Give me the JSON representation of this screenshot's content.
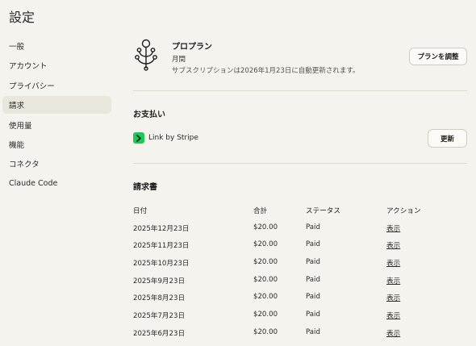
{
  "page": {
    "title": "設定"
  },
  "sidebar": {
    "items": [
      {
        "label": "一般"
      },
      {
        "label": "アカウント"
      },
      {
        "label": "プライバシー"
      },
      {
        "label": "請求",
        "active": true
      },
      {
        "label": "使用量"
      },
      {
        "label": "機能"
      },
      {
        "label": "コネクタ"
      },
      {
        "label": "Claude Code"
      }
    ]
  },
  "plan": {
    "icon": "plan-tree-icon",
    "name": "プロプラン",
    "cycle": "月間",
    "renewal_text": "サブスクリプションは2026年1月23日に自動更新されます。",
    "adjust_label": "プランを調整"
  },
  "payment": {
    "title": "お支払い",
    "method_icon": "link-stripe-icon",
    "method_label": "Link by Stripe",
    "update_label": "更新",
    "accent_color": "#1fc65b"
  },
  "invoices": {
    "title": "請求書",
    "columns": [
      "日付",
      "合計",
      "ステータス",
      "アクション"
    ],
    "rows": [
      {
        "date": "2025年12月23日",
        "total": "$20.00",
        "status": "Paid",
        "action": "表示"
      },
      {
        "date": "2025年11月23日",
        "total": "$20.00",
        "status": "Paid",
        "action": "表示"
      },
      {
        "date": "2025年10月23日",
        "total": "$20.00",
        "status": "Paid",
        "action": "表示"
      },
      {
        "date": "2025年9月23日",
        "total": "$20.00",
        "status": "Paid",
        "action": "表示"
      },
      {
        "date": "2025年8月23日",
        "total": "$20.00",
        "status": "Paid",
        "action": "表示"
      },
      {
        "date": "2025年7月23日",
        "total": "$20.00",
        "status": "Paid",
        "action": "表示"
      },
      {
        "date": "2025年6月23日",
        "total": "$20.00",
        "status": "Paid",
        "action": "表示"
      }
    ]
  }
}
